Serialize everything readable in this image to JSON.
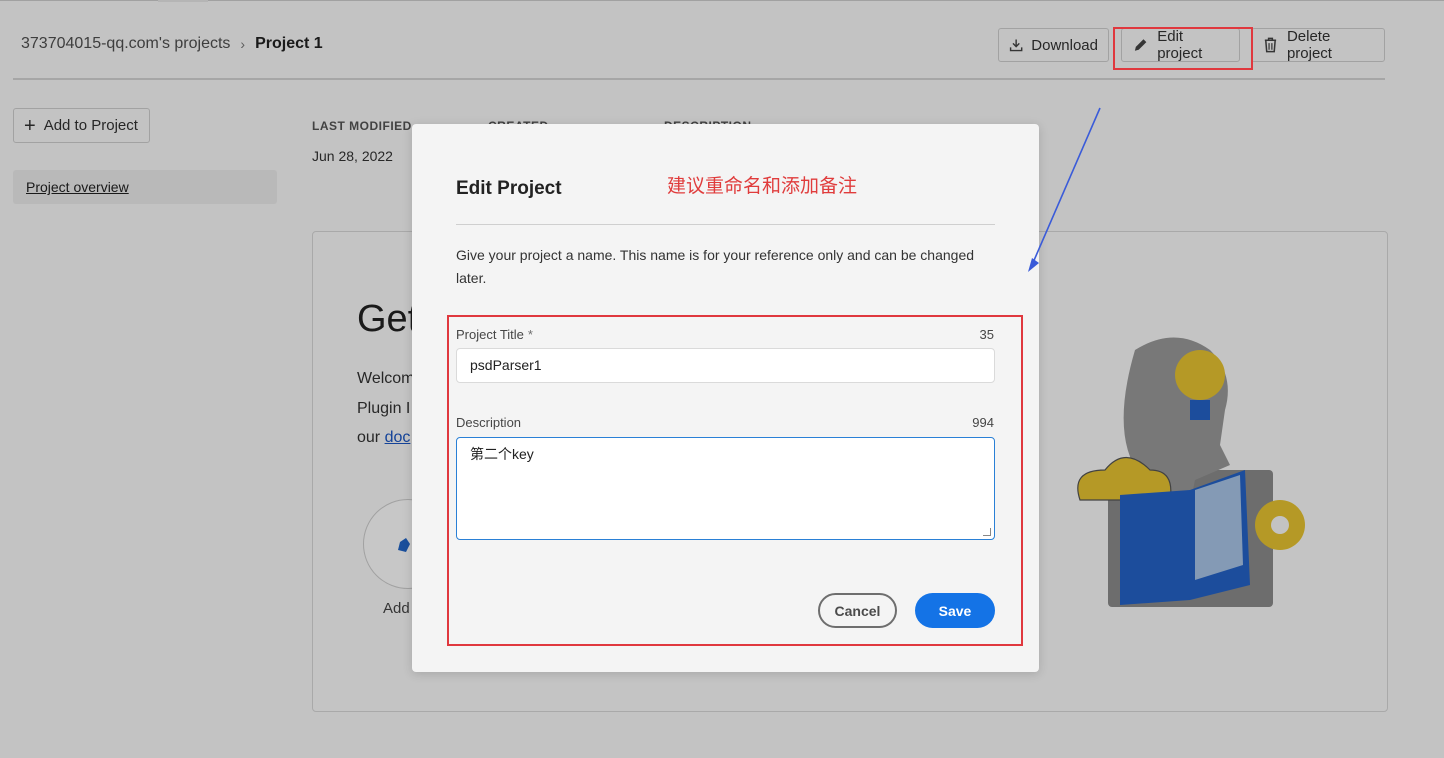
{
  "breadcrumb": {
    "parent": "373704015-qq.com's projects",
    "separator": "›",
    "current": "Project 1"
  },
  "toolbar": {
    "download_label": "Download",
    "edit_label": "Edit project",
    "delete_label": "Delete project"
  },
  "sidebar": {
    "add_label": "Add to Project",
    "overview_label": "Project overview"
  },
  "meta": {
    "last_modified_label": "LAST MODIFIED",
    "last_modified_value": "Jun 28, 2022",
    "created_label": "CREATED",
    "description_label": "DESCRIPTION"
  },
  "card": {
    "title": "Get",
    "line1": "Welcom",
    "line2": "Plugin I",
    "line3_prefix": "our ",
    "line3_link": "doc",
    "circle_label": "Add"
  },
  "dialog": {
    "title": "Edit Project",
    "annotation": "建议重命名和添加备注",
    "description": "Give your project a name. This name is for your reference only and can be changed later.",
    "title_field": {
      "label": "Project Title",
      "required_mark": "*",
      "count": "35",
      "value": "psdParser1"
    },
    "description_field": {
      "label": "Description",
      "count": "994",
      "value": "第二个key"
    },
    "cancel_label": "Cancel",
    "save_label": "Save"
  },
  "colors": {
    "accent": "#1473e6",
    "annotation_red": "#e0383e",
    "arrow_blue": "#3a5bd9"
  },
  "icons": {
    "download": "download-icon",
    "edit": "pencil-icon",
    "delete": "trash-icon",
    "add": "plus-icon"
  }
}
